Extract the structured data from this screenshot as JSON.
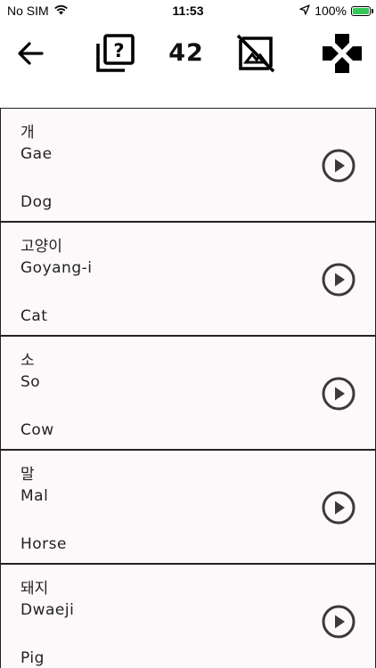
{
  "status_bar": {
    "carrier": "No SIM",
    "time": "11:53",
    "battery_percent": "100%",
    "icons": [
      "wifi-icon",
      "location-arrow-icon",
      "battery-charging-icon"
    ]
  },
  "toolbar": {
    "count": "42",
    "buttons": [
      "back-arrow-icon",
      "quiz-cards-icon",
      "hide-images-icon",
      "game-controller-icon"
    ]
  },
  "words": [
    {
      "korean": "개",
      "romanization": "Gae",
      "english": "Dog"
    },
    {
      "korean": "고양이",
      "romanization": "Goyang-i",
      "english": "Cat"
    },
    {
      "korean": "소",
      "romanization": "So",
      "english": "Cow"
    },
    {
      "korean": "말",
      "romanization": "Mal",
      "english": "Horse"
    },
    {
      "korean": "돼지",
      "romanization": "Dwaeji",
      "english": "Pig"
    }
  ],
  "colors": {
    "card_background": "#fdf9fa",
    "border": "#222222",
    "battery": "#34c759"
  }
}
